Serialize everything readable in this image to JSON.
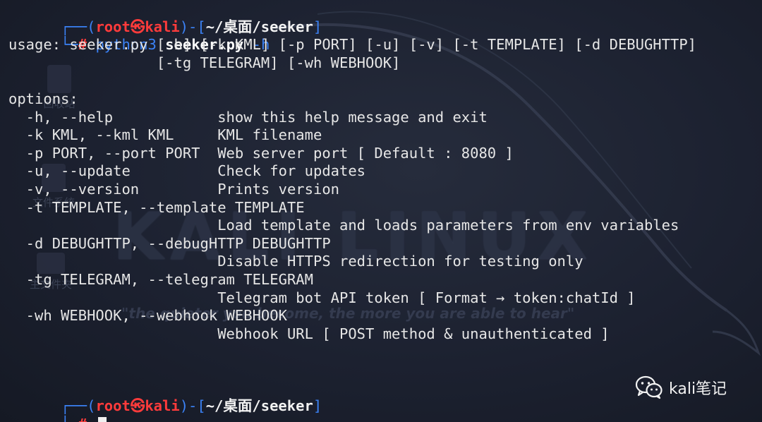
{
  "wallpaper": {
    "logo_text": "KALI LINUX",
    "tagline": "\"the quieter you become, the more you are able to hear\"",
    "desktop_icons": [
      "回收站",
      "文件系统",
      "主文件夹"
    ]
  },
  "prompt1": {
    "frame_open": "┌──(",
    "user": "root",
    "skull": "㉿",
    "host": "kali",
    "frame_mid": ")-[",
    "cwd": "~/桌面/seeker",
    "frame_close": "]",
    "frame_bottom": "└─",
    "hash": "#",
    "command": "python3",
    "argument": "seeker.py",
    "flag": "-h"
  },
  "output": [
    "usage: seeker.py [-h] [-k KML] [-p PORT] [-u] [-v] [-t TEMPLATE] [-d DEBUGHTTP]",
    "                 [-tg TELEGRAM] [-wh WEBHOOK]",
    "",
    "options:",
    "  -h, --help            show this help message and exit",
    "  -k KML, --kml KML     KML filename",
    "  -p PORT, --port PORT  Web server port [ Default : 8080 ]",
    "  -u, --update          Check for updates",
    "  -v, --version         Prints version",
    "  -t TEMPLATE, --template TEMPLATE",
    "                        Load template and loads parameters from env variables",
    "  -d DEBUGHTTP, --debugHTTP DEBUGHTTP",
    "                        Disable HTTPS redirection for testing only",
    "  -tg TELEGRAM, --telegram TELEGRAM",
    "                        Telegram bot API token [ Format → token:chatId ]",
    "  -wh WEBHOOK, --webhook WEBHOOK",
    "                        Webhook URL [ POST method & unauthenticated ]",
    "",
    ""
  ],
  "prompt2": {
    "frame_open": "┌──(",
    "user": "root",
    "skull": "㉿",
    "host": "kali",
    "frame_mid": ")-[",
    "cwd": "~/桌面/seeker",
    "frame_close": "]",
    "frame_bottom": "└─",
    "hash": "#"
  },
  "watermark": {
    "text": "kali笔记",
    "icon": "wechat-icon"
  },
  "colors": {
    "prompt_frame": "#3b82f6",
    "root_user": "#ff3b3b",
    "terminal_text": "#e6e6e6",
    "background": "#1c2130"
  }
}
